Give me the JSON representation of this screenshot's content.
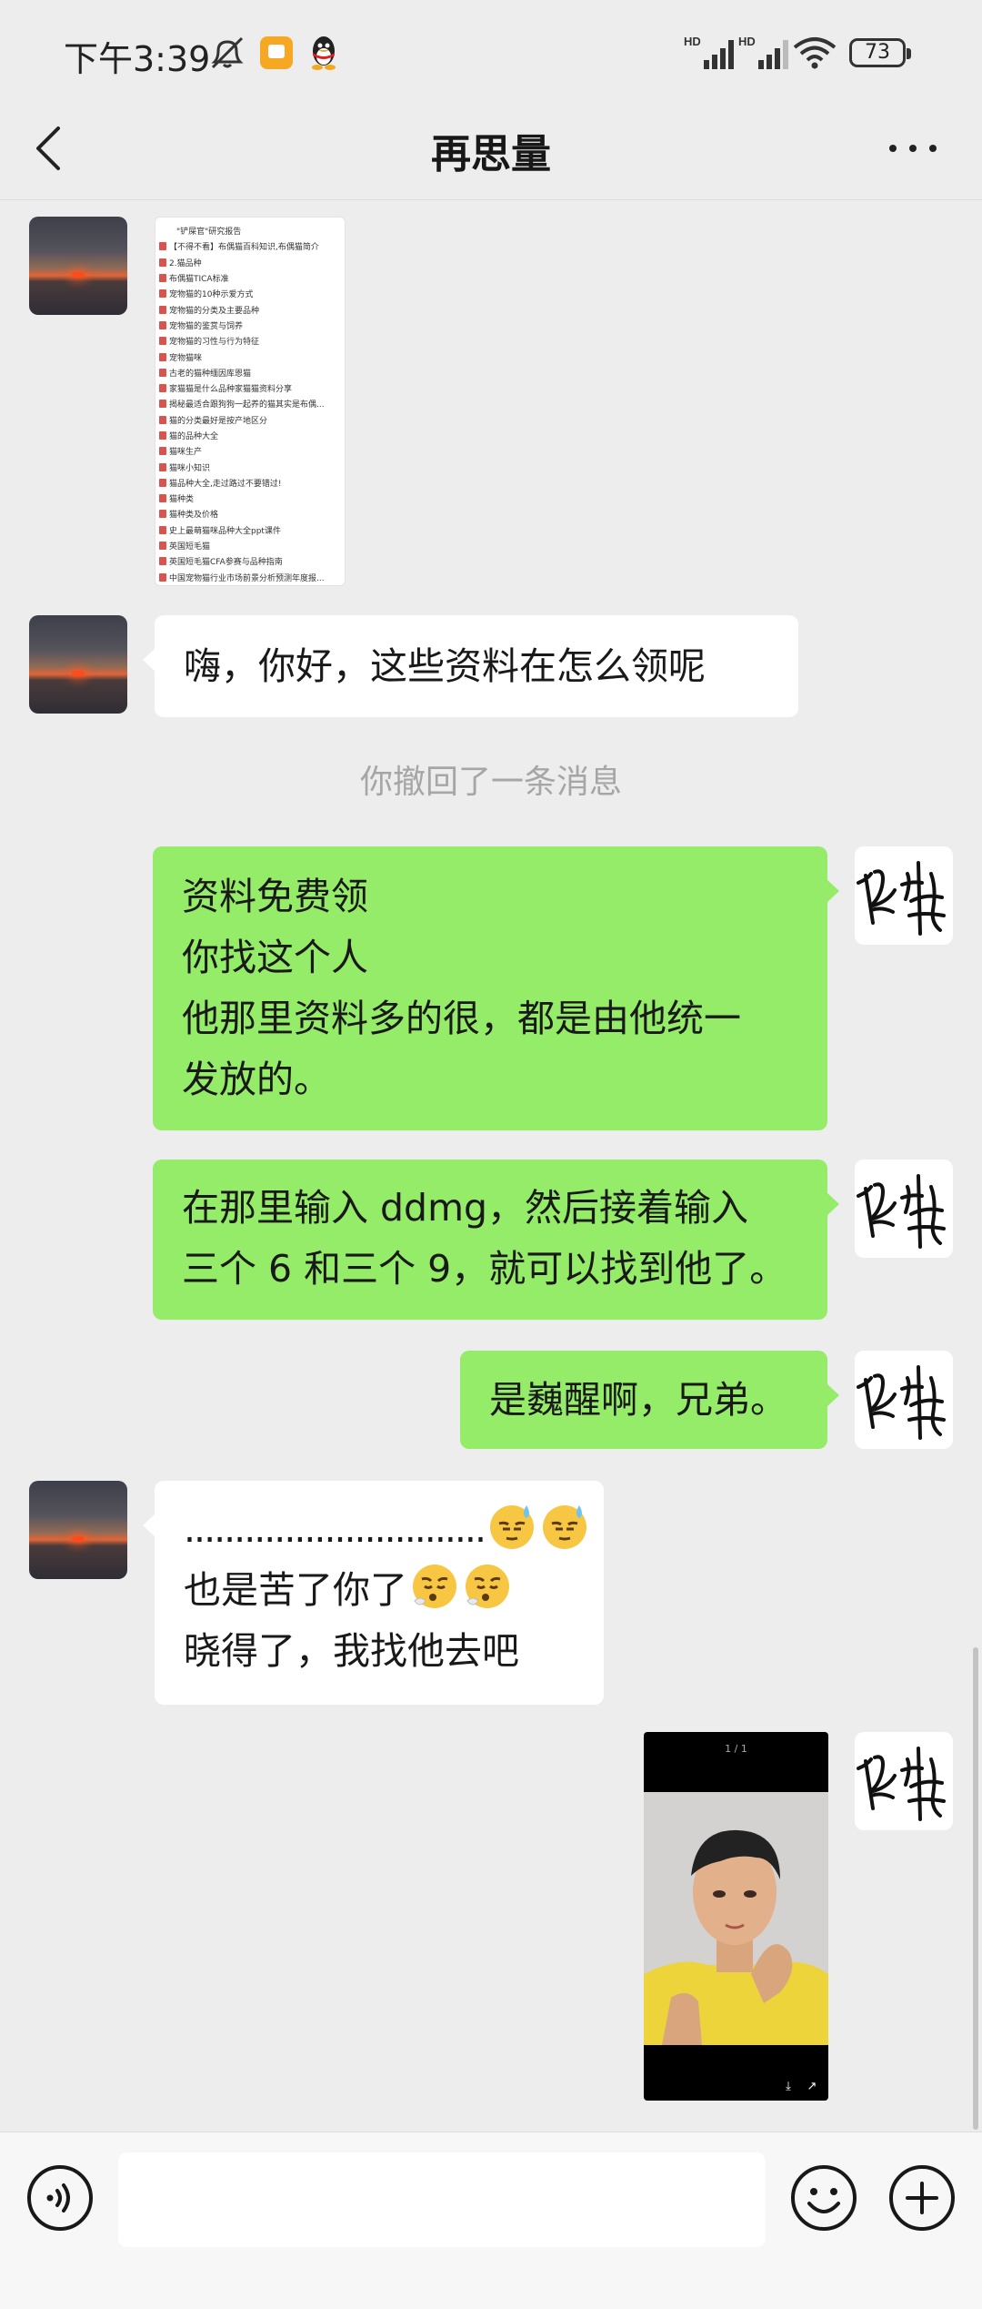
{
  "status_bar": {
    "time": "下午3:39",
    "signal_1_label": "HD",
    "signal_2_label": "HD",
    "battery": "73"
  },
  "header": {
    "title": "再思量",
    "back_icon": "chevron-left-icon",
    "more_icon": "more-dots-icon"
  },
  "document": {
    "items": [
      "\"铲屎官\"研究报告",
      "【不得不看】布偶猫百科知识,布偶猫简介",
      "2.猫品种",
      "布偶猫TICA标准",
      "宠物猫的10种示爱方式",
      "宠物猫的分类及主要品种",
      "宠物猫的鉴赏与饲养",
      "宠物猫的习性与行为特征",
      "宠物猫咪",
      "古老的猫种缅因库恩猫",
      "家猫猫是什么品种家猫猫资料分享",
      "揭秘最适合跟狗狗一起养的猫其实是布偶...",
      "猫的分类最好是按产地区分",
      "猫的品种大全",
      "猫咪生产",
      "猫咪小知识",
      "猫品种大全,走过路过不要错过!",
      "猫种类",
      "猫种类及价格",
      "史上最萌猫咪品种大全ppt课件",
      "英国短毛猫",
      "英国短毛猫CFA参赛与品种指南",
      "中国宠物猫行业市场前景分析预测年度报..."
    ]
  },
  "messages": {
    "m1": "嗨，你好，这些资料在怎么领呢",
    "recall": "你撤回了一条消息",
    "m2": [
      "资料免费领",
      "你找这个人",
      "他那里资料多的很，都是由他统一",
      "发放的。"
    ],
    "m3": [
      "在那里输入 ddmg，然后接着输入",
      "三个 6 和三个 9，就可以找到他了。"
    ],
    "m4": "是巍醒啊，兄弟。",
    "m5": {
      "line1": "..............................",
      "line2": "也是苦了你了",
      "line3": "晓得了，我找他去吧"
    },
    "video_counter": "1 / 1"
  },
  "input_bar": {
    "placeholder": "",
    "voice_icon": "voice-icon",
    "emoji_icon": "emoji-icon",
    "plus_icon": "plus-icon"
  },
  "colors": {
    "background": "#ededed",
    "bubble_out": "#95ec69",
    "bubble_in": "#ffffff"
  }
}
